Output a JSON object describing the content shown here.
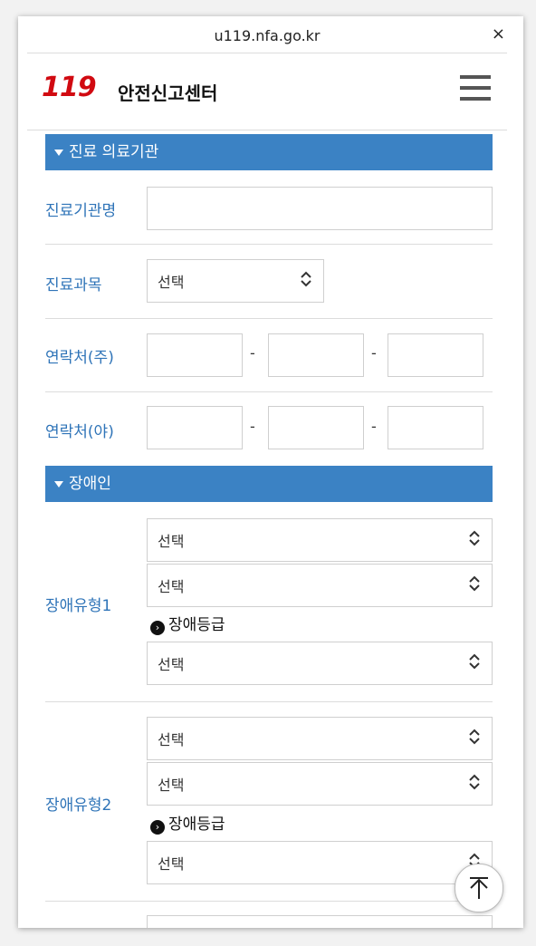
{
  "browser": {
    "url": "u119.nfa.go.kr",
    "close_label": "×"
  },
  "header": {
    "logo_mark": "119",
    "logo_text": "안전신고센터"
  },
  "section_medical": {
    "title": "진료 의료기관",
    "fields": {
      "institution_label": "진료기관명",
      "subject_label": "진료과목",
      "subject_value": "선택",
      "phone_day_label": "연락처(주)",
      "phone_night_label": "연락처(야)",
      "dash": "-"
    }
  },
  "section_disability": {
    "title": "장애인",
    "type1": {
      "label": "장애유형1",
      "select1": "선택",
      "select2": "선택",
      "grade_label": "장애등급",
      "grade_select": "선택"
    },
    "type2": {
      "label": "장애유형2",
      "select1": "선택",
      "select2": "선택",
      "grade_label": "장애등급",
      "grade_select": "선택"
    }
  },
  "icons": {
    "grade": "chevron-right-circle-icon",
    "scroll_top": "arrow-up-icon",
    "menu": "hamburger-icon"
  }
}
